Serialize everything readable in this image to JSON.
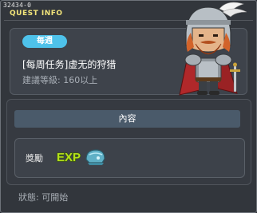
{
  "window": {
    "id_text": "32434-0",
    "title": "QUEST INFO"
  },
  "quest": {
    "badge": "每週",
    "name": "[每周任务]虚无的狩猎",
    "requirement": "建議等級: 160以上"
  },
  "content": {
    "header": "內容",
    "reward_label": "獎勵",
    "exp_text": "EXP"
  },
  "status": "狀態:  可開始",
  "colors": {
    "title": "#f2e47a",
    "badge": "#4ec2ea",
    "exp": "#b4e01a"
  },
  "icons": {
    "portrait": "knight-npc-portrait",
    "exp": "exp-icon",
    "item": "helmet-item-icon"
  }
}
